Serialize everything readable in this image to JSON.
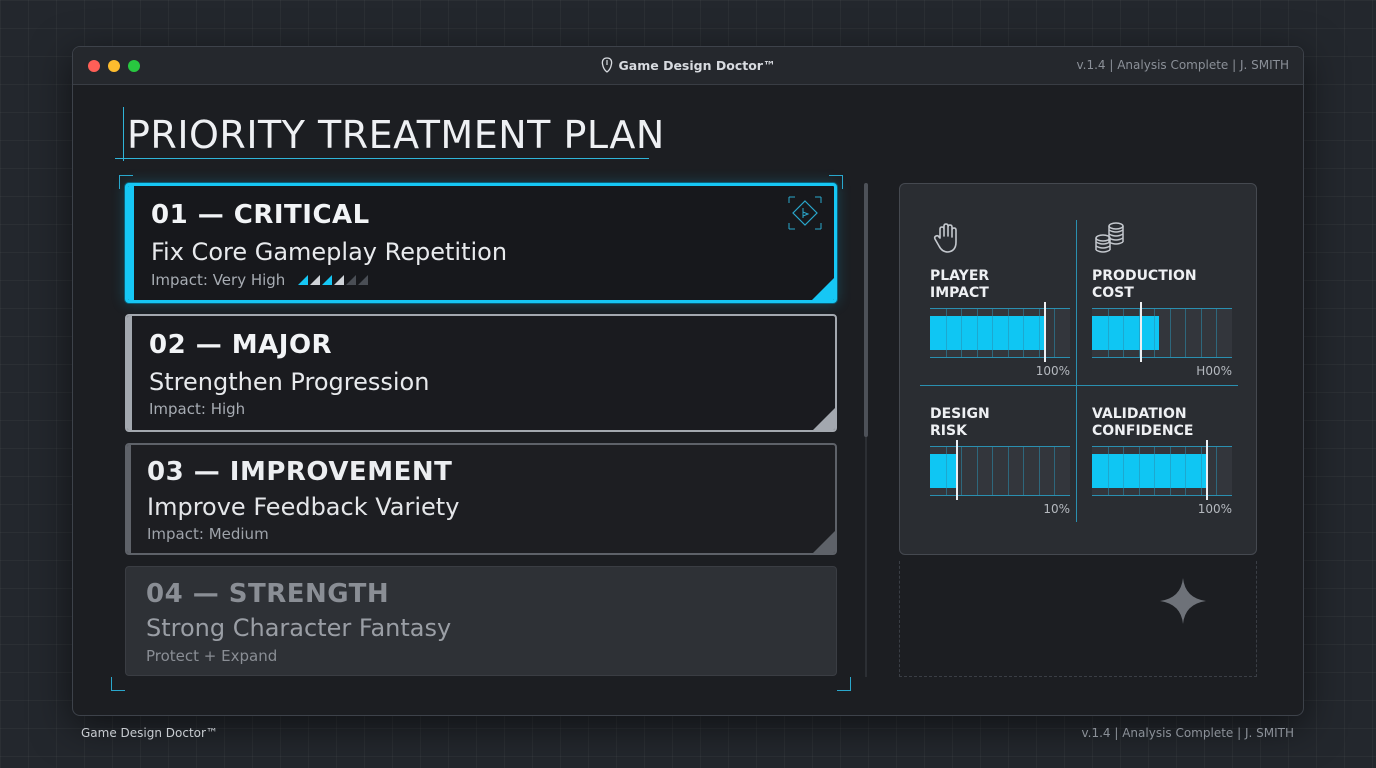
{
  "window": {
    "app_title": "Game Design Doctor™",
    "status": "v.1.4 | Analysis Complete | J. SMITH"
  },
  "page": {
    "title": "PRIORITY TREATMENT PLAN"
  },
  "plan_items": [
    {
      "number": "01 — CRITICAL",
      "title": "Fix Core Gameplay Repetition",
      "impact": "Impact: Very High",
      "impact_level": 4,
      "impact_max": 6
    },
    {
      "number": "02 — MAJOR",
      "title": "Strengthen Progression",
      "impact": "Impact: High"
    },
    {
      "number": "03 — IMPROVEMENT",
      "title": "Improve Feedback Variety",
      "impact": "Impact: Medium"
    },
    {
      "number": "04 — STRENGTH",
      "title": "Strong Character Fantasy",
      "impact": "Protect + Expand"
    }
  ],
  "metrics": [
    {
      "label_line1": "PLAYER",
      "label_line2": "IMPACT",
      "icon": "hand-icon",
      "fill": 0.82,
      "percent_text": "100%"
    },
    {
      "label_line1": "PRODUCTION",
      "label_line2": "COST",
      "icon": "coins-icon",
      "fill": 0.48,
      "percent_text": "H00%"
    },
    {
      "label_line1": "DESIGN",
      "label_line2": "RISK",
      "icon": "",
      "fill": 0.2,
      "percent_text": "10%"
    },
    {
      "label_line1": "VALIDATION",
      "label_line2": "CONFIDENCE",
      "icon": "",
      "fill": 0.83,
      "percent_text": "100%"
    }
  ],
  "footer": {
    "left": "Game Design Doctor™",
    "right": "v.1.4 | Analysis Complete | J. SMITH"
  },
  "colors": {
    "accent": "#16c7f5",
    "major": "#a3a8af",
    "improvement": "#5e6269"
  }
}
